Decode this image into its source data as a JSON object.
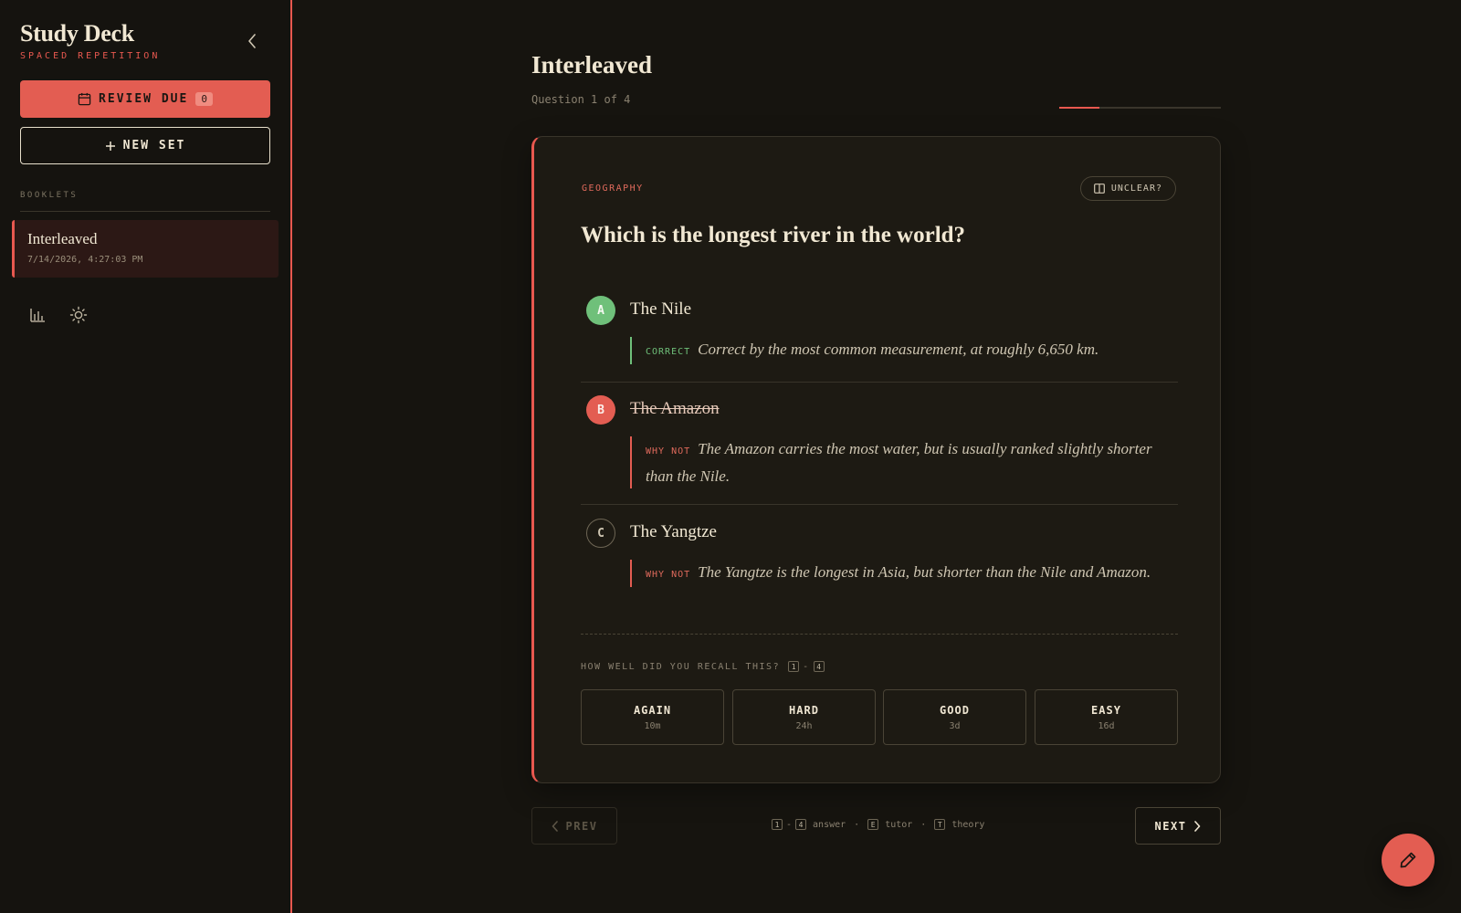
{
  "sidebar": {
    "brand_title": "Study Deck",
    "brand_subtitle": "SPACED REPETITION",
    "review_label": "REVIEW DUE",
    "review_count": "0",
    "new_set_label": "NEW SET",
    "booklets_label": "BOOKLETS",
    "booklets": [
      {
        "title": "Interleaved",
        "date": "7/14/2026, 4:27:03 PM"
      }
    ],
    "icons": [
      "stats-chart-icon",
      "theme-sun-icon"
    ]
  },
  "main": {
    "title": "Interleaved",
    "subtitle": "Question 1 of 4",
    "progress": 0.25
  },
  "card": {
    "category": "GEOGRAPHY",
    "unclear_label": "UNCLEAR?",
    "question": "Which is the longest river in the world?",
    "options": [
      {
        "letter": "A",
        "text": "The Nile",
        "tag": "CORRECT",
        "explanation": "Correct by the most common measurement, at roughly 6,650 km."
      },
      {
        "letter": "B",
        "text": "The Amazon",
        "tag": "WHY NOT",
        "explanation": "The Amazon carries the most water, but is usually ranked slightly shorter than the Nile."
      },
      {
        "letter": "C",
        "text": "The Yangtze",
        "tag": "WHY NOT",
        "explanation": "The Yangtze is the longest in Asia, but shorter than the Nile and Amazon."
      }
    ],
    "recall_label": "HOW WELL DID YOU RECALL THIS?",
    "recall_key_start": "1",
    "recall_key_dash": "-",
    "recall_key_end": "4",
    "grades": [
      {
        "label": "AGAIN",
        "interval": "10m"
      },
      {
        "label": "HARD",
        "interval": "24h"
      },
      {
        "label": "GOOD",
        "interval": "3d"
      },
      {
        "label": "EASY",
        "interval": "16d"
      }
    ]
  },
  "footer": {
    "prev_label": "PREV",
    "next_label": "NEXT",
    "shortcuts": {
      "key_1": "1",
      "dash": "-",
      "key_4": "4",
      "answer": "answer",
      "sep": "·",
      "key_e": "E",
      "tutor": "tutor",
      "key_t": "T",
      "theory": "theory"
    }
  },
  "colors": {
    "accent": "#e35d52",
    "correct": "#6fc07a",
    "background": "#16140f",
    "card": "#1d1a13"
  }
}
